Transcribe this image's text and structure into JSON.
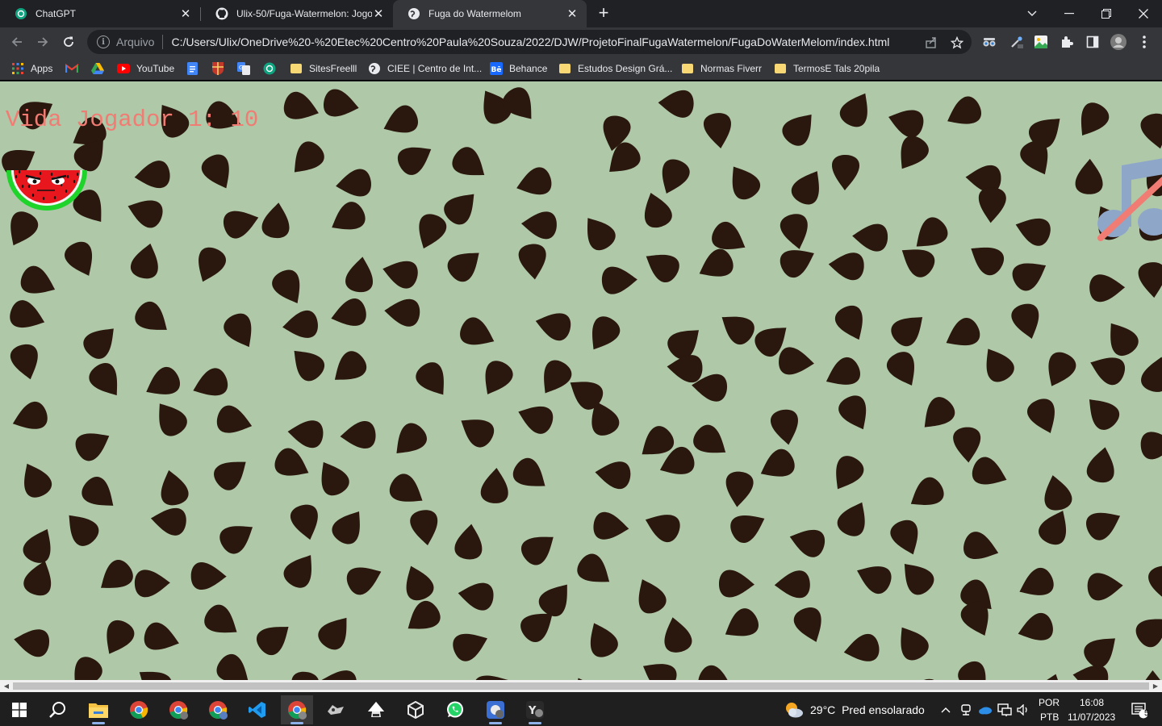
{
  "browser": {
    "tabs": [
      {
        "title": "ChatGPT",
        "icon": "chatgpt-icon",
        "active": false
      },
      {
        "title": "Ulix-50/Fuga-Watermelon: Jogo",
        "icon": "github-icon",
        "active": false
      },
      {
        "title": "Fuga do Watermelom",
        "icon": "globe-icon",
        "active": true
      }
    ],
    "omnibox": {
      "scheme_label": "Arquivo",
      "url": "C:/Users/Ulix/OneDrive%20-%20Etec%20Centro%20Paula%20Souza/2022/DJW/ProjetoFinalFugaWatermelon/FugaDoWaterMelom/index.html"
    },
    "bookmarks": [
      {
        "label": "Apps",
        "icon": "apps-grid-icon"
      },
      {
        "label": "",
        "icon": "gmail-icon"
      },
      {
        "label": "",
        "icon": "google-drive-icon"
      },
      {
        "label": "YouTube",
        "icon": "youtube-icon"
      },
      {
        "label": "",
        "icon": "google-docs-icon"
      },
      {
        "label": "",
        "icon": "university-icon"
      },
      {
        "label": "",
        "icon": "google-translate-icon"
      },
      {
        "label": "",
        "icon": "chatgpt-icon"
      },
      {
        "label": "SitesFreelll",
        "icon": "folder-icon"
      },
      {
        "label": "CIEE | Centro de Int...",
        "icon": "ciee-icon"
      },
      {
        "label": "Behance",
        "icon": "behance-icon"
      },
      {
        "label": "Estudos Design Grá...",
        "icon": "folder-icon"
      },
      {
        "label": "Normas Fiverr",
        "icon": "folder-icon"
      },
      {
        "label": "TermosE Tals 20pila",
        "icon": "folder-icon"
      }
    ]
  },
  "game": {
    "hud_text": "Vida Jogador 1: 10",
    "player": "watermelon-player",
    "music_toggle": "music-off-icon",
    "colors": {
      "background": "#afc8a7",
      "seed": "#2a170d",
      "hud": "#f07c74",
      "music": "#8ea7c9",
      "slash": "#f07c74"
    }
  },
  "taskbar": {
    "apps": [
      "windows-start-icon",
      "search-icon",
      "file-explorer-icon",
      "chrome-icon",
      "chrome-profile-icon",
      "chrome-profile-icon",
      "vscode-icon",
      "chrome-active-icon",
      "app-icon",
      "inkscape-icon",
      "unity-icon",
      "whatsapp-icon",
      "chrome-profile-icon",
      "app-icon"
    ],
    "weather": {
      "temp": "29°C",
      "condition": "Pred ensolarado"
    },
    "lang_top": "POR",
    "lang_bottom": "PTB",
    "time": "16:08",
    "date": "11/07/2023",
    "notifications": "5"
  }
}
